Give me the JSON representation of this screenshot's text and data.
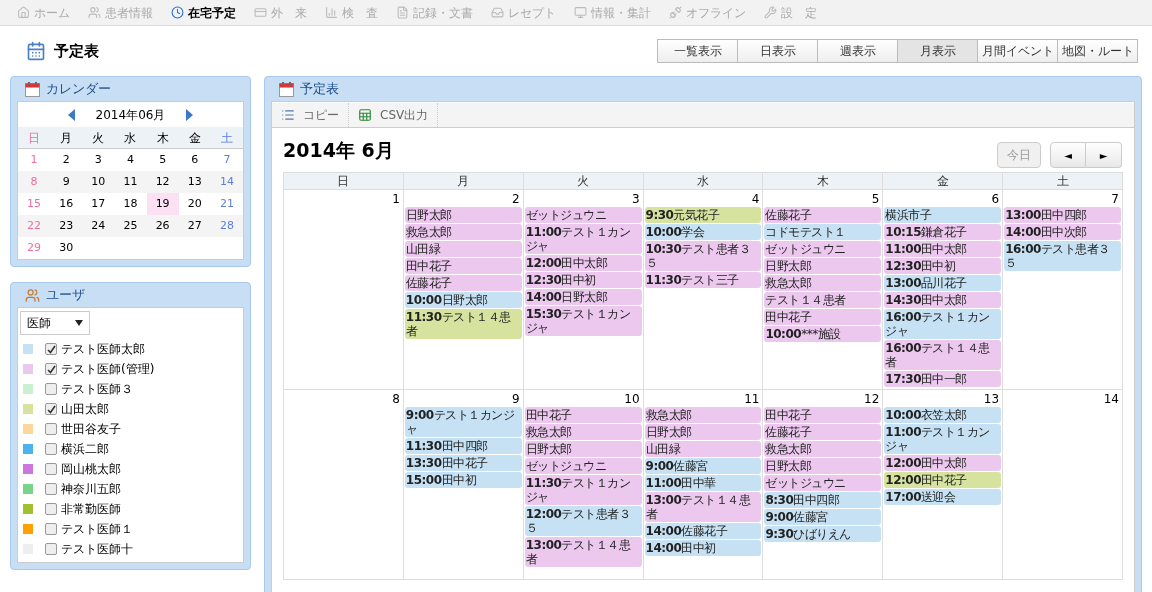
{
  "nav": [
    {
      "label": "ホーム",
      "selected": false
    },
    {
      "label": "患者情報",
      "selected": false
    },
    {
      "label": "在宅予定",
      "selected": true
    },
    {
      "label": "外　来",
      "selected": false
    },
    {
      "label": "検　査",
      "selected": false
    },
    {
      "label": "記録・文書",
      "selected": false
    },
    {
      "label": "レセプト",
      "selected": false
    },
    {
      "label": "情報・集計",
      "selected": false
    },
    {
      "label": "オフライン",
      "selected": false
    },
    {
      "label": "設　定",
      "selected": false
    }
  ],
  "page_title": "予定表",
  "view_tabs": [
    {
      "label": "一覧表示",
      "selected": false
    },
    {
      "label": "日表示",
      "selected": false
    },
    {
      "label": "週表示",
      "selected": false
    },
    {
      "label": "月表示",
      "selected": true
    },
    {
      "label": "月間イベント",
      "selected": false
    },
    {
      "label": "地図・ルート",
      "selected": false
    }
  ],
  "calendar_panel": {
    "title": "カレンダー",
    "month": "2014年06月",
    "weekdays": [
      "日",
      "月",
      "火",
      "水",
      "木",
      "金",
      "土"
    ],
    "weeks": [
      [
        {
          "day": "1",
          "selected": false
        },
        {
          "day": "2",
          "selected": false
        },
        {
          "day": "3",
          "selected": false
        },
        {
          "day": "4",
          "selected": false
        },
        {
          "day": "5",
          "selected": false
        },
        {
          "day": "6",
          "selected": false
        },
        {
          "day": "7",
          "selected": false
        }
      ],
      [
        {
          "day": "8",
          "selected": false
        },
        {
          "day": "9",
          "selected": false
        },
        {
          "day": "10",
          "selected": false
        },
        {
          "day": "11",
          "selected": false
        },
        {
          "day": "12",
          "selected": false
        },
        {
          "day": "13",
          "selected": false
        },
        {
          "day": "14",
          "selected": false
        }
      ],
      [
        {
          "day": "15",
          "selected": false
        },
        {
          "day": "16",
          "selected": false
        },
        {
          "day": "17",
          "selected": false
        },
        {
          "day": "18",
          "selected": false
        },
        {
          "day": "19",
          "selected": true
        },
        {
          "day": "20",
          "selected": false
        },
        {
          "day": "21",
          "selected": false
        }
      ],
      [
        {
          "day": "22",
          "selected": false
        },
        {
          "day": "23",
          "selected": false
        },
        {
          "day": "24",
          "selected": false
        },
        {
          "day": "25",
          "selected": false
        },
        {
          "day": "26",
          "selected": false
        },
        {
          "day": "27",
          "selected": false
        },
        {
          "day": "28",
          "selected": false
        }
      ],
      [
        {
          "day": "29",
          "selected": false
        },
        {
          "day": "30",
          "selected": false
        }
      ]
    ]
  },
  "user_panel": {
    "title": "ユーザ",
    "filter": "医師",
    "users": [
      {
        "name": "テスト医師太郎",
        "checked": true,
        "color": "#c5e1f3"
      },
      {
        "name": "テスト医師(管理)",
        "checked": true,
        "color": "#ecc8ef"
      },
      {
        "name": "テスト医師３",
        "checked": false,
        "color": "#c9f0cf"
      },
      {
        "name": "山田太郎",
        "checked": true,
        "color": "#d5e39f"
      },
      {
        "name": "世田谷友子",
        "checked": false,
        "color": "#fdd69b"
      },
      {
        "name": "横浜二郎",
        "checked": false,
        "color": "#4db3ef"
      },
      {
        "name": "岡山桃太郎",
        "checked": false,
        "color": "#cc77dd"
      },
      {
        "name": "神奈川五郎",
        "checked": false,
        "color": "#77d488"
      },
      {
        "name": "非常勤医師",
        "checked": false,
        "color": "#a0c030"
      },
      {
        "name": "テスト医師１",
        "checked": false,
        "color": "#ff9f00"
      },
      {
        "name": "テスト医師十",
        "checked": false,
        "color": "#eeeeee"
      }
    ]
  },
  "schedule_panel": {
    "title": "予定表",
    "toolbar": [
      "コピー",
      "CSV出力"
    ],
    "month_title": "2014年 6月",
    "today_button": "今日",
    "prev_button": "◄",
    "next_button": "►",
    "weekdays": [
      "日",
      "月",
      "火",
      "水",
      "木",
      "金",
      "土"
    ],
    "weeks": [
      [
        {
          "day": "1"
        },
        {
          "day": "2",
          "events": [
            {
              "name": "日野太郎",
              "color": "#ecc8ef"
            },
            {
              "name": "救急太郎",
              "color": "#ecc8ef"
            },
            {
              "name": "山田緑",
              "color": "#ecc8ef"
            },
            {
              "name": "田中花子",
              "color": "#ecc8ef"
            },
            {
              "name": "佐藤花子",
              "color": "#ecc8ef"
            },
            {
              "time": "10:00",
              "name": "日野太郎",
              "color": "#c5e1f3"
            },
            {
              "time": "11:30",
              "name": "テスト１４患者",
              "color": "#d5e39f"
            }
          ]
        },
        {
          "day": "3",
          "events": [
            {
              "name": "ゼットジュウニ",
              "color": "#ecc8ef"
            },
            {
              "time": "11:00",
              "name": "テスト１カンジャ",
              "color": "#ecc8ef"
            },
            {
              "time": "12:00",
              "name": "田中太郎",
              "color": "#ecc8ef"
            },
            {
              "time": "12:30",
              "name": "田中初",
              "color": "#ecc8ef"
            },
            {
              "time": "14:00",
              "name": "日野太郎",
              "color": "#ecc8ef"
            },
            {
              "time": "15:30",
              "name": "テスト１カンジャ",
              "color": "#ecc8ef"
            }
          ]
        },
        {
          "day": "4",
          "events": [
            {
              "time": "9:30",
              "name": "元気花子",
              "color": "#d5e39f"
            },
            {
              "time": "10:00",
              "name": "学会",
              "color": "#c5e1f3"
            },
            {
              "time": "10:30",
              "name": "テスト患者３５",
              "color": "#ecc8ef"
            },
            {
              "time": "11:30",
              "name": "テスト三子",
              "color": "#ecc8ef"
            }
          ]
        },
        {
          "day": "5",
          "events": [
            {
              "name": "佐藤花子",
              "color": "#ecc8ef"
            },
            {
              "name": "コドモテスト１",
              "color": "#c5e1f3"
            },
            {
              "name": "ゼットジュウニ",
              "color": "#ecc8ef"
            },
            {
              "name": "日野太郎",
              "color": "#ecc8ef"
            },
            {
              "name": "救急太郎",
              "color": "#ecc8ef"
            },
            {
              "name": "テスト１４患者",
              "color": "#ecc8ef"
            },
            {
              "name": "田中花子",
              "color": "#ecc8ef"
            },
            {
              "time": "10:00",
              "name": "***施設",
              "color": "#ecc8ef"
            }
          ]
        },
        {
          "day": "6",
          "events": [
            {
              "name": "横浜市子",
              "color": "#c5e1f3"
            },
            {
              "time": "10:15",
              "name": "鎌倉花子",
              "color": "#ecc8ef"
            },
            {
              "time": "11:00",
              "name": "田中太郎",
              "color": "#ecc8ef"
            },
            {
              "time": "12:30",
              "name": "田中初",
              "color": "#ecc8ef"
            },
            {
              "time": "13:00",
              "name": "品川花子",
              "color": "#c5e1f3"
            },
            {
              "time": "14:30",
              "name": "田中太郎",
              "color": "#ecc8ef"
            },
            {
              "time": "16:00",
              "name": "テスト１カンジャ",
              "color": "#c5e1f3"
            },
            {
              "time": "16:00",
              "name": "テスト１４患者",
              "color": "#ecc8ef"
            },
            {
              "time": "17:30",
              "name": "田中一郎",
              "color": "#ecc8ef"
            }
          ]
        },
        {
          "day": "7",
          "events": [
            {
              "time": "13:00",
              "name": "田中四郎",
              "color": "#ecc8ef"
            },
            {
              "time": "14:00",
              "name": "田中次郎",
              "color": "#ecc8ef"
            },
            {
              "time": "16:00",
              "name": "テスト患者３５",
              "color": "#c5e1f3"
            }
          ]
        }
      ],
      [
        {
          "day": "8"
        },
        {
          "day": "9",
          "events": [
            {
              "time": "9:00",
              "name": "テスト１カンジャ",
              "color": "#c5e1f3"
            },
            {
              "time": "11:30",
              "name": "田中四郎",
              "color": "#c5e1f3"
            },
            {
              "time": "13:30",
              "name": "田中花子",
              "color": "#c5e1f3"
            },
            {
              "time": "15:00",
              "name": "田中初",
              "color": "#c5e1f3"
            }
          ]
        },
        {
          "day": "10",
          "events": [
            {
              "name": "田中花子",
              "color": "#ecc8ef"
            },
            {
              "name": "救急太郎",
              "color": "#ecc8ef"
            },
            {
              "name": "日野太郎",
              "color": "#ecc8ef"
            },
            {
              "name": "ゼットジュウニ",
              "color": "#ecc8ef"
            },
            {
              "time": "11:30",
              "name": "テスト１カンジャ",
              "color": "#ecc8ef"
            },
            {
              "time": "12:00",
              "name": "テスト患者３５",
              "color": "#c5e1f3"
            },
            {
              "time": "13:00",
              "name": "テスト１４患者",
              "color": "#ecc8ef"
            }
          ]
        },
        {
          "day": "11",
          "events": [
            {
              "name": "救急太郎",
              "color": "#ecc8ef"
            },
            {
              "name": "日野太郎",
              "color": "#ecc8ef"
            },
            {
              "name": "山田緑",
              "color": "#ecc8ef"
            },
            {
              "time": "9:00",
              "name": "佐藤宮",
              "color": "#c5e1f3"
            },
            {
              "time": "11:00",
              "name": "田中華",
              "color": "#c5e1f3"
            },
            {
              "time": "13:00",
              "name": "テスト１４患者",
              "color": "#ecc8ef"
            },
            {
              "time": "14:00",
              "name": "佐藤花子",
              "color": "#c5e1f3"
            },
            {
              "time": "14:00",
              "name": "田中初",
              "color": "#c5e1f3"
            }
          ]
        },
        {
          "day": "12",
          "events": [
            {
              "name": "田中花子",
              "color": "#ecc8ef"
            },
            {
              "name": "佐藤花子",
              "color": "#ecc8ef"
            },
            {
              "name": "救急太郎",
              "color": "#ecc8ef"
            },
            {
              "name": "日野太郎",
              "color": "#ecc8ef"
            },
            {
              "name": "ゼットジュウニ",
              "color": "#ecc8ef"
            },
            {
              "time": "8:30",
              "name": "田中四郎",
              "color": "#c5e1f3"
            },
            {
              "time": "9:00",
              "name": "佐藤宮",
              "color": "#c5e1f3"
            },
            {
              "time": "9:30",
              "name": "ひばりえん",
              "color": "#c5e1f3"
            }
          ]
        },
        {
          "day": "13",
          "events": [
            {
              "time": "10:00",
              "name": "衣笠太郎",
              "color": "#c5e1f3"
            },
            {
              "time": "11:00",
              "name": "テスト１カンジャ",
              "color": "#c5e1f3"
            },
            {
              "time": "12:00",
              "name": "田中太郎",
              "color": "#ecc8ef"
            },
            {
              "time": "12:00",
              "name": "田中花子",
              "color": "#d5e39f"
            },
            {
              "time": "17:00",
              "name": "送迎会",
              "color": "#c5e1f3"
            }
          ]
        },
        {
          "day": "14"
        }
      ]
    ]
  }
}
